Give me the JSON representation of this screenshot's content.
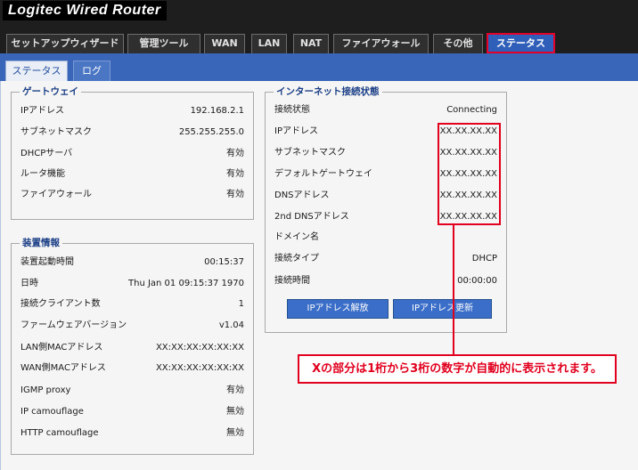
{
  "header": {
    "brand": "Logitec Wired Router"
  },
  "main_tabs": [
    {
      "label": "セットアップウィザード"
    },
    {
      "label": "管理ツール"
    },
    {
      "label": "WAN"
    },
    {
      "label": "LAN"
    },
    {
      "label": "NAT"
    },
    {
      "label": "ファイアウォール"
    },
    {
      "label": "その他"
    },
    {
      "label": "ステータス",
      "active": true
    }
  ],
  "sub_tabs": [
    {
      "label": "ステータス",
      "active": true
    },
    {
      "label": "ログ"
    }
  ],
  "gateway": {
    "title": "ゲートウェイ",
    "rows": [
      {
        "label": "IPアドレス",
        "value": "192.168.2.1"
      },
      {
        "label": "サブネットマスク",
        "value": "255.255.255.0"
      },
      {
        "label": "DHCPサーバ",
        "value": "有効"
      },
      {
        "label": "ルータ機能",
        "value": "有効"
      },
      {
        "label": "ファイアウォール",
        "value": "有効"
      }
    ]
  },
  "device": {
    "title": "装置情報",
    "rows": [
      {
        "label": "装置起動時間",
        "value": "00:15:37"
      },
      {
        "label": "日時",
        "value": "Thu Jan 01 09:15:37 1970"
      },
      {
        "label": "接続クライアント数",
        "value": "1"
      },
      {
        "label": "ファームウェアバージョン",
        "value": "v1.04"
      },
      {
        "label": "LAN側MACアドレス",
        "value": "XX:XX:XX:XX:XX:XX"
      },
      {
        "label": "WAN側MACアドレス",
        "value": "XX:XX:XX:XX:XX:XX"
      },
      {
        "label": "IGMP proxy",
        "value": "有効"
      },
      {
        "label": "IP camouflage",
        "value": "無効"
      },
      {
        "label": "HTTP camouflage",
        "value": "無効"
      }
    ]
  },
  "internet": {
    "title": "インターネット接続状態",
    "rows": [
      {
        "label": "接続状態",
        "value": "Connecting"
      },
      {
        "label": "IPアドレス",
        "value": "XX.XX.XX.XX"
      },
      {
        "label": "サブネットマスク",
        "value": "XX.XX.XX.XX"
      },
      {
        "label": "デフォルトゲートウェイ",
        "value": "XX.XX.XX.XX"
      },
      {
        "label": "DNSアドレス",
        "value": "XX.XX.XX.XX"
      },
      {
        "label": "2nd DNSアドレス",
        "value": "XX.XX.XX.XX"
      },
      {
        "label": "ドメイン名",
        "value": ""
      },
      {
        "label": "接続タイプ",
        "value": "DHCP"
      },
      {
        "label": "接続時間",
        "value": "00:00:00"
      }
    ],
    "release_button": "IPアドレス解放",
    "renew_button": "IPアドレス更新"
  },
  "annotation": {
    "text": "Xの部分は1桁から3桁の数字が自動的に表示されます。"
  },
  "colors": {
    "accent": "#3966b8",
    "highlight": "#e1001e",
    "label_blue": "#1c3f86"
  }
}
